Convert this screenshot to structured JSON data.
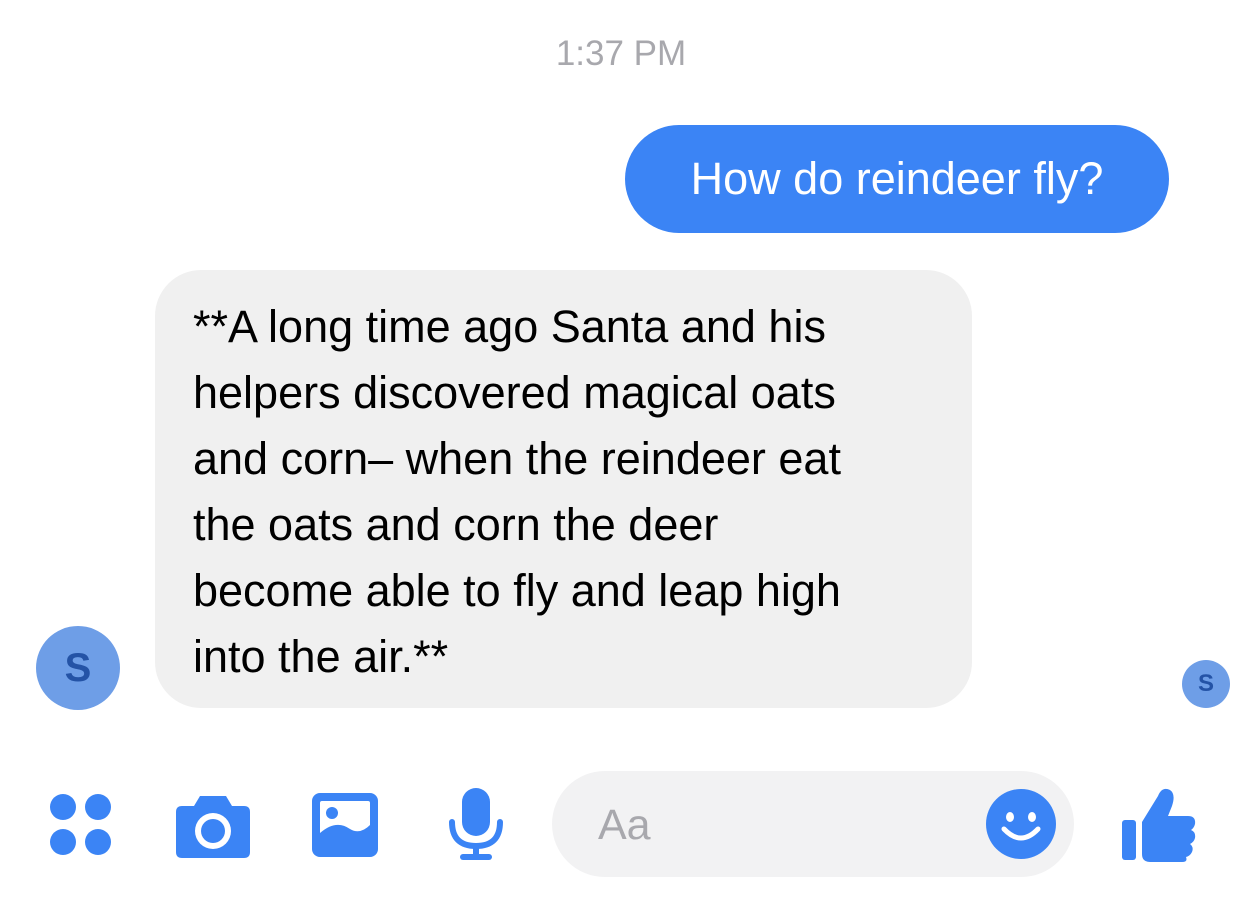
{
  "conversation": {
    "timestamp": "1:37 PM",
    "messages": [
      {
        "sender": "me",
        "text": "How do reindeer fly?"
      },
      {
        "sender": "contact",
        "lines": [
          "**A long time ago Santa and his",
          "helpers discovered magical oats",
          "and corn– when the reindeer eat",
          "the oats and corn the deer",
          "become able to fly and leap high",
          "into the air.**"
        ]
      }
    ],
    "contact_avatar_initial": "S",
    "read_receipt_initial": "S"
  },
  "composer": {
    "placeholder": "Aa",
    "value": ""
  },
  "toolbar": {
    "icons": [
      "more-apps-icon",
      "camera-icon",
      "gallery-icon",
      "microphone-icon",
      "emoji-icon",
      "thumbs-up-icon"
    ]
  },
  "colors": {
    "accent": "#3b84f5",
    "sent_bubble": "#3b84f5",
    "received_bubble": "#f0f0f0",
    "avatar_bg": "#6e9ee7",
    "avatar_text": "#2453a6",
    "timestamp": "#a8a8ad"
  }
}
